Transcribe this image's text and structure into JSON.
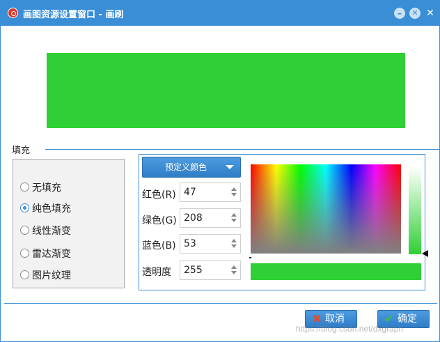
{
  "window": {
    "title": "画图资源设置窗口 - 画刷",
    "accent_color": "#3a8ed6",
    "icons": [
      "app-icon",
      "minimize-icon",
      "restore-icon",
      "close-icon"
    ]
  },
  "preview": {
    "color": "#2fd035"
  },
  "fill": {
    "group_label": "填充",
    "options": [
      {
        "label": "无填充",
        "checked": false
      },
      {
        "label": "纯色填充",
        "checked": true
      },
      {
        "label": "线性渐变",
        "checked": false
      },
      {
        "label": "雷达渐变",
        "checked": false
      },
      {
        "label": "图片纹理",
        "checked": false
      }
    ]
  },
  "color": {
    "preset_label": "预定义颜色",
    "red_label": "红色(R)",
    "red_value": "47",
    "green_label": "绿色(G)",
    "green_value": "208",
    "blue_label": "蓝色(B)",
    "blue_value": "53",
    "alpha_label": "透明度",
    "alpha_value": "255",
    "current_color": "#2fd035"
  },
  "footer": {
    "cancel_label": "取消",
    "ok_label": "确定",
    "watermark": "https://blog.csdn.net/dxgraph"
  }
}
